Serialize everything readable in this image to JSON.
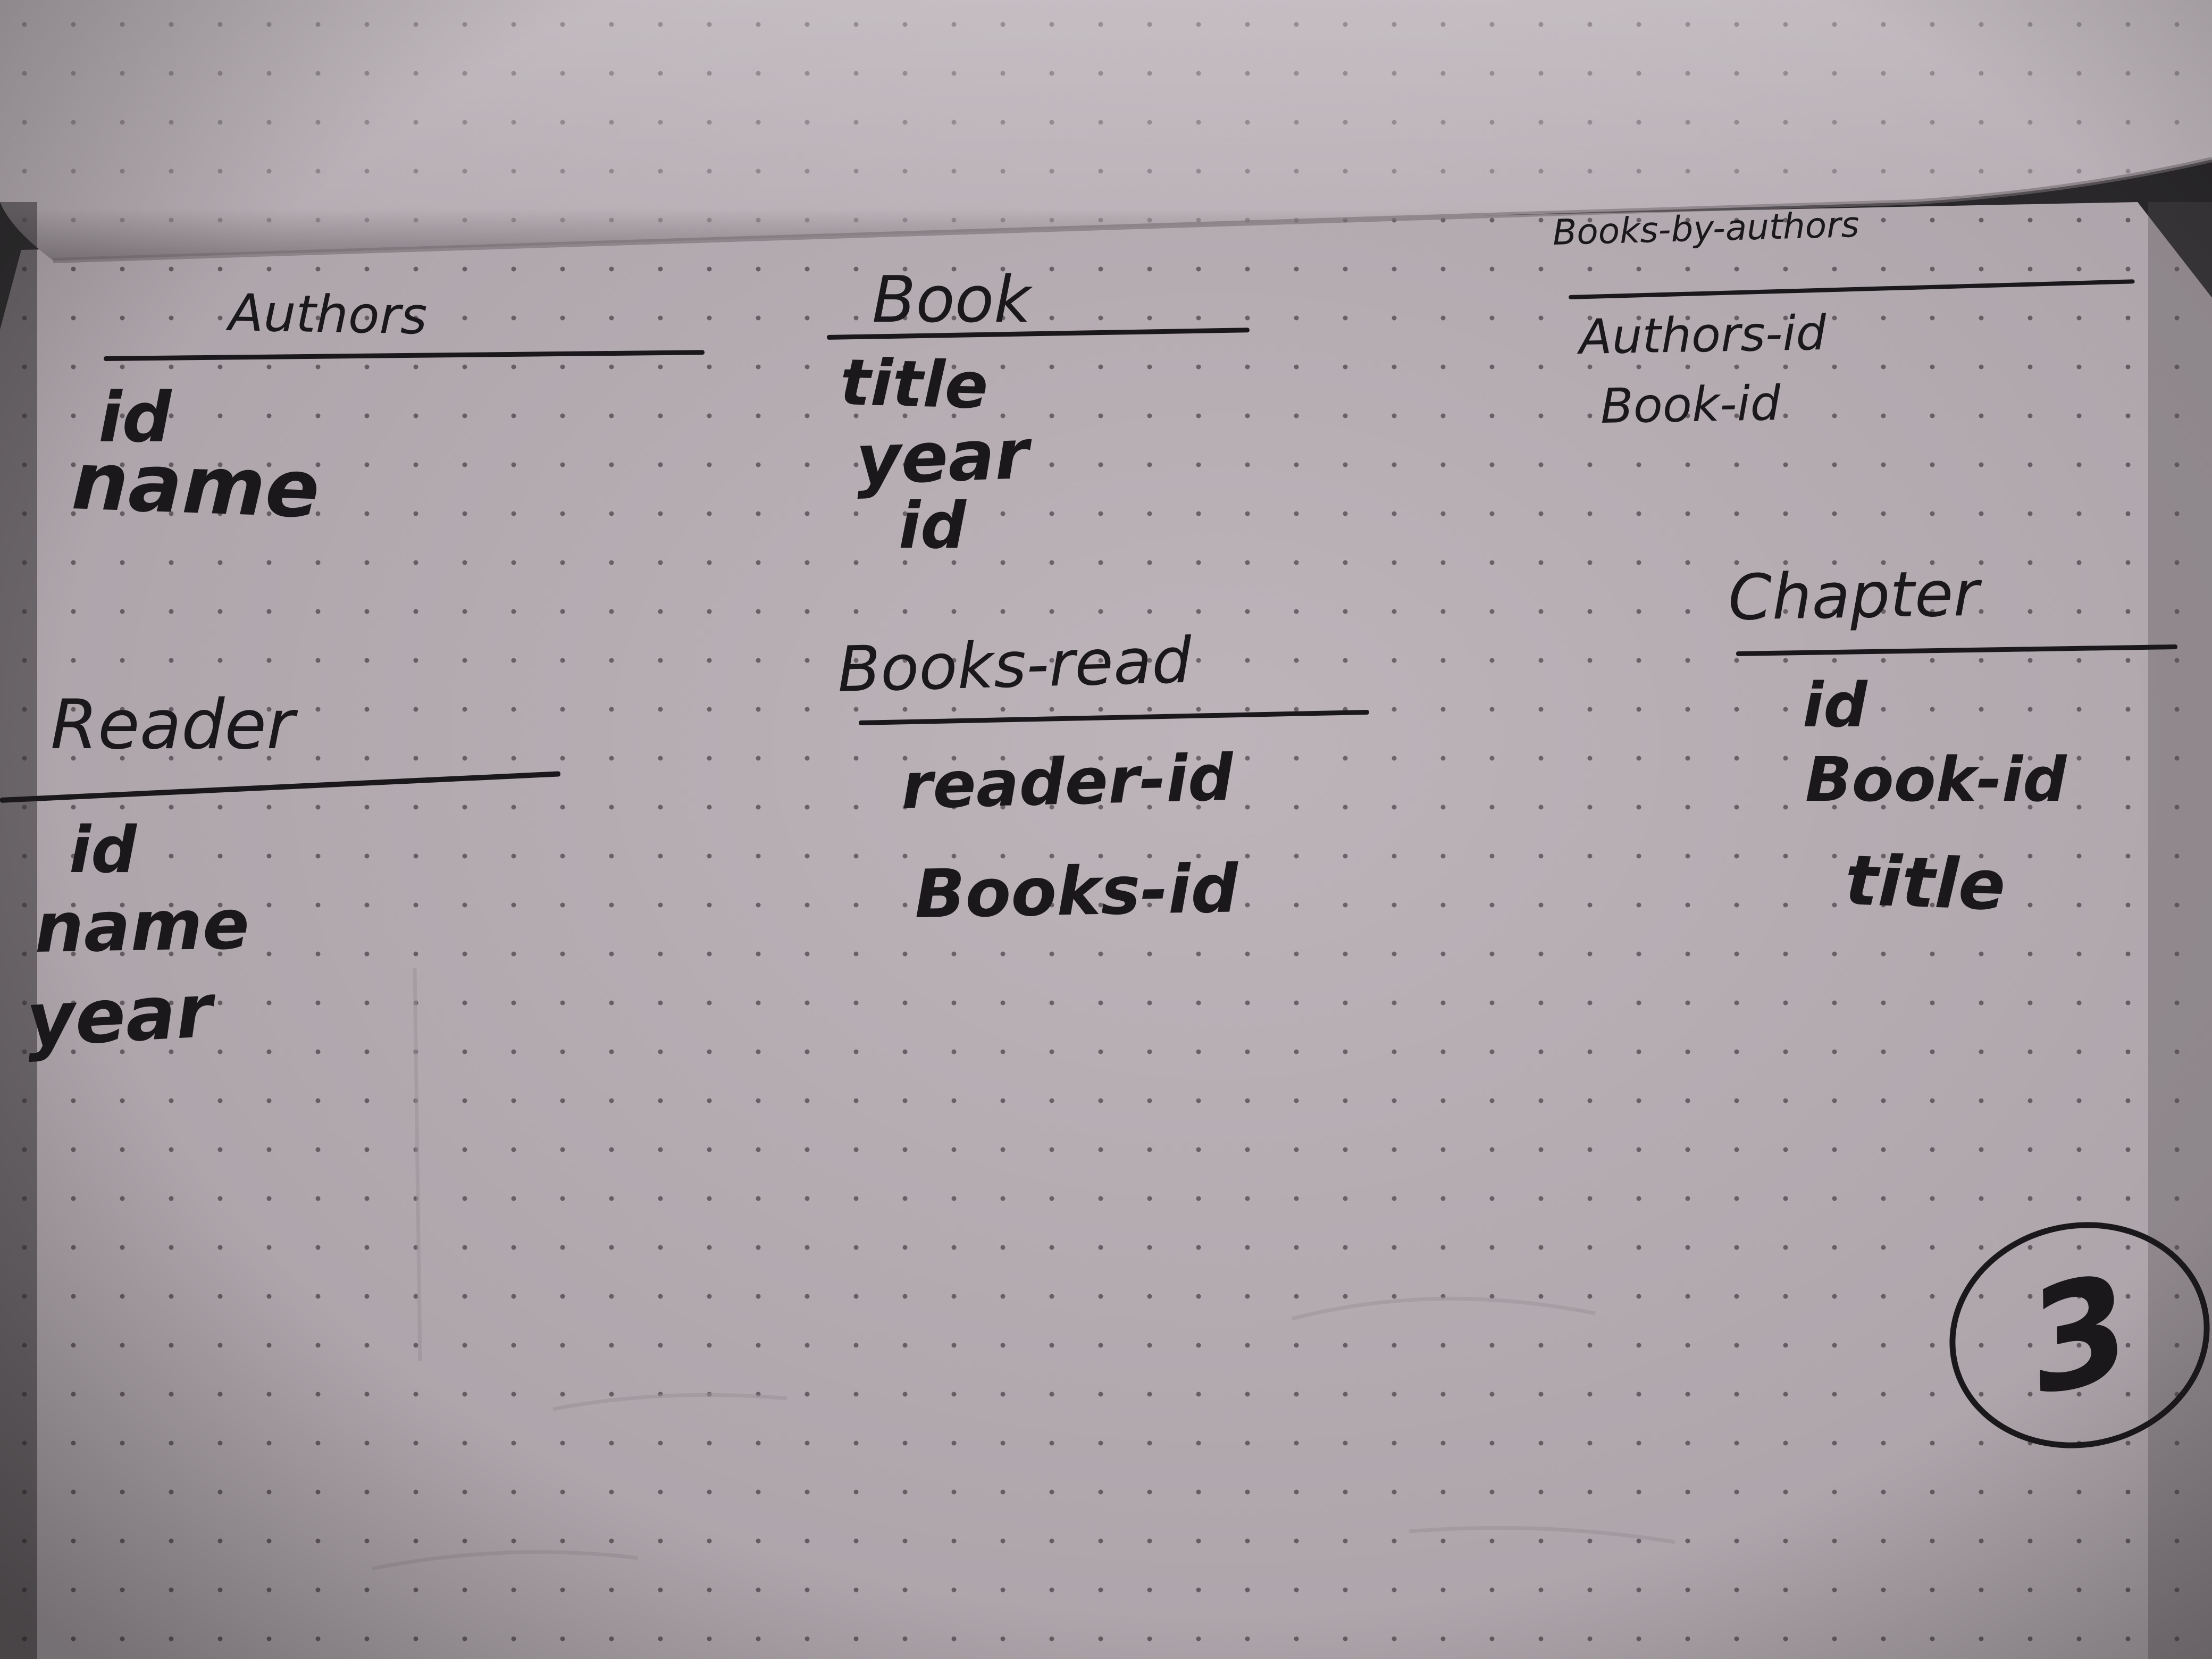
{
  "notebook_sketch": {
    "tables": [
      {
        "heading": "Authors",
        "fields": [
          "id",
          "name"
        ]
      },
      {
        "heading": "Book",
        "fields": [
          "title",
          "year",
          "id"
        ]
      },
      {
        "heading": "Books-by-authors",
        "fields": [
          "Authors-id",
          "Book-id"
        ]
      },
      {
        "heading": "Reader",
        "fields": [
          "id",
          "name",
          "year"
        ]
      },
      {
        "heading": "Books-read",
        "fields": [
          "reader-id",
          "Books-id"
        ]
      },
      {
        "heading": "Chapter",
        "fields": [
          "id",
          "Book-id",
          "title"
        ]
      }
    ],
    "page_number": "3"
  },
  "colors": {
    "paper": "#bdb4ba",
    "ink": "#1b181c",
    "background": "#2c2a2d",
    "previous_page": "#cfc6cb"
  }
}
